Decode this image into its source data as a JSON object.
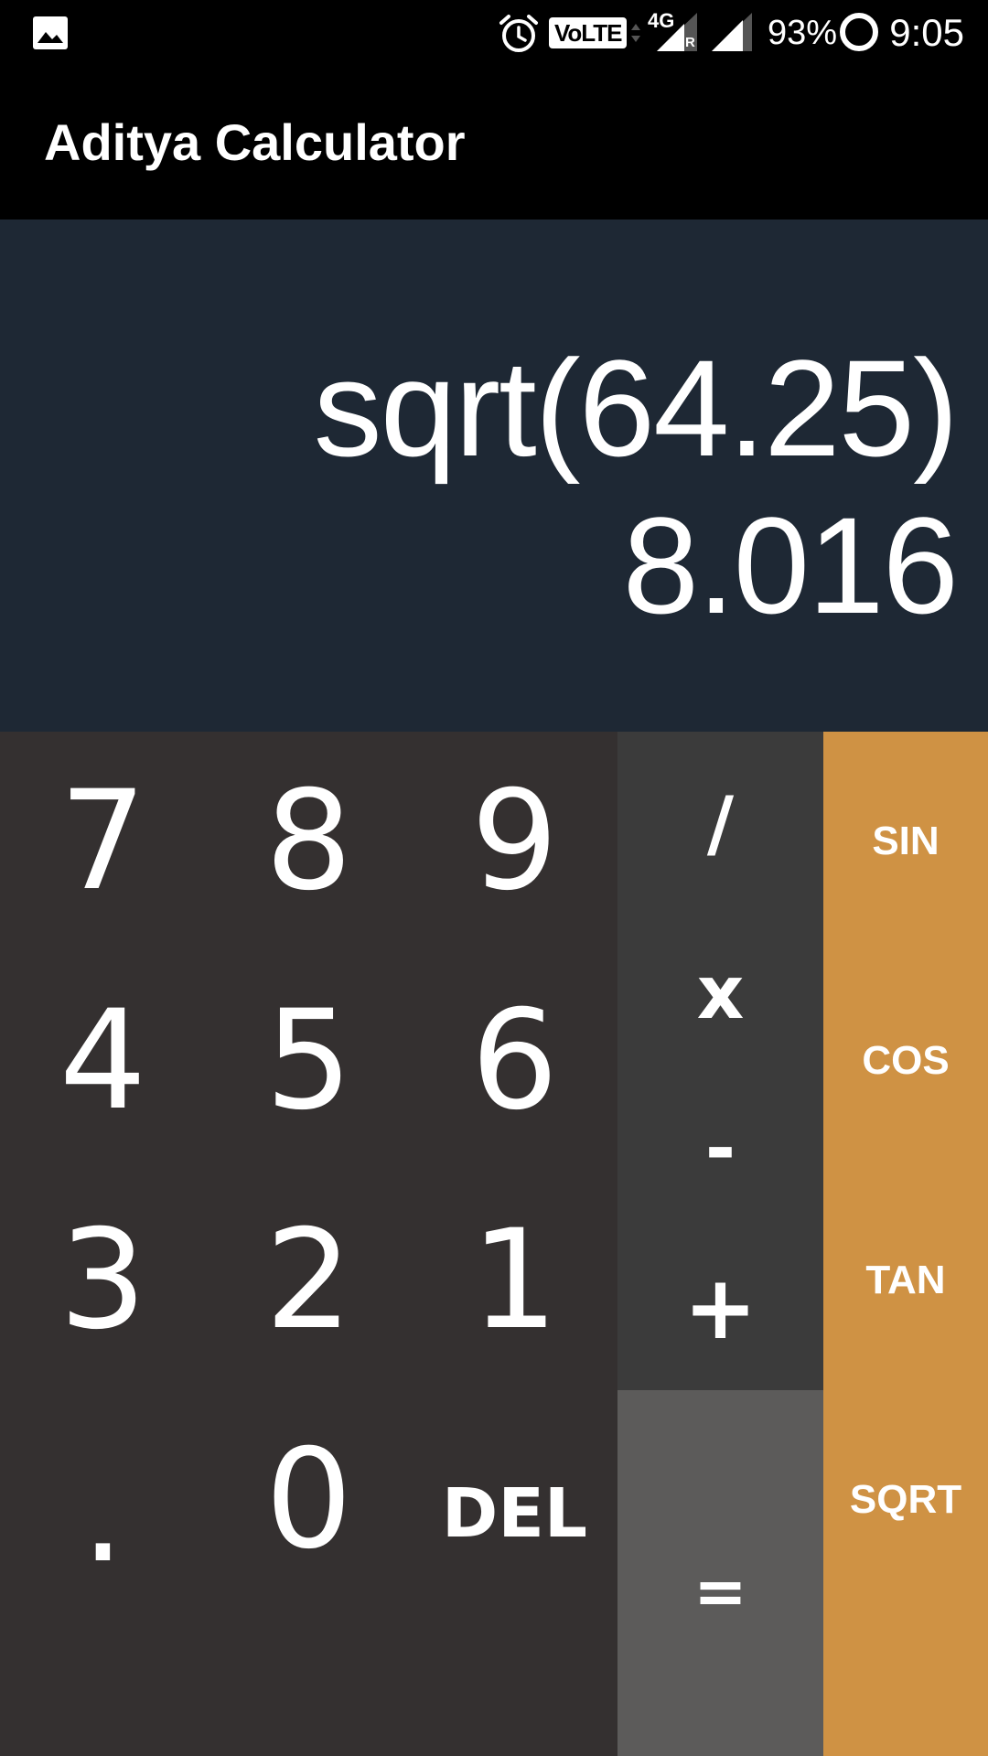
{
  "status_bar": {
    "gallery_icon": "image-icon",
    "alarm_icon": "alarm-clock-icon",
    "volte_label": "VoLTE",
    "network_label": "4G",
    "roaming_label": "R",
    "battery_percent": "93%",
    "time": "9:05"
  },
  "app_bar": {
    "title": "Aditya Calculator"
  },
  "display": {
    "expression": "sqrt(64.25)",
    "result": "8.016"
  },
  "keypad": {
    "digits": {
      "k7": "7",
      "k8": "8",
      "k9": "9",
      "k4": "4",
      "k5": "5",
      "k6": "6",
      "k3": "3",
      "k2": "2",
      "k1": "1",
      "dot": ".",
      "k0": "0",
      "del": "DEL"
    },
    "operators": {
      "divide": "/",
      "multiply": "x",
      "subtract": "-",
      "add": "+",
      "equals": "="
    },
    "functions": {
      "sin": "SIN",
      "cos": "COS",
      "tan": "TAN",
      "sqrt": "SQRT"
    }
  },
  "colors": {
    "display_bg": "#1e2834",
    "digits_bg": "#343030",
    "operators_bg": "#3b3b3b",
    "equals_bg": "#5c5b5a",
    "functions_bg": "#cf9244"
  }
}
